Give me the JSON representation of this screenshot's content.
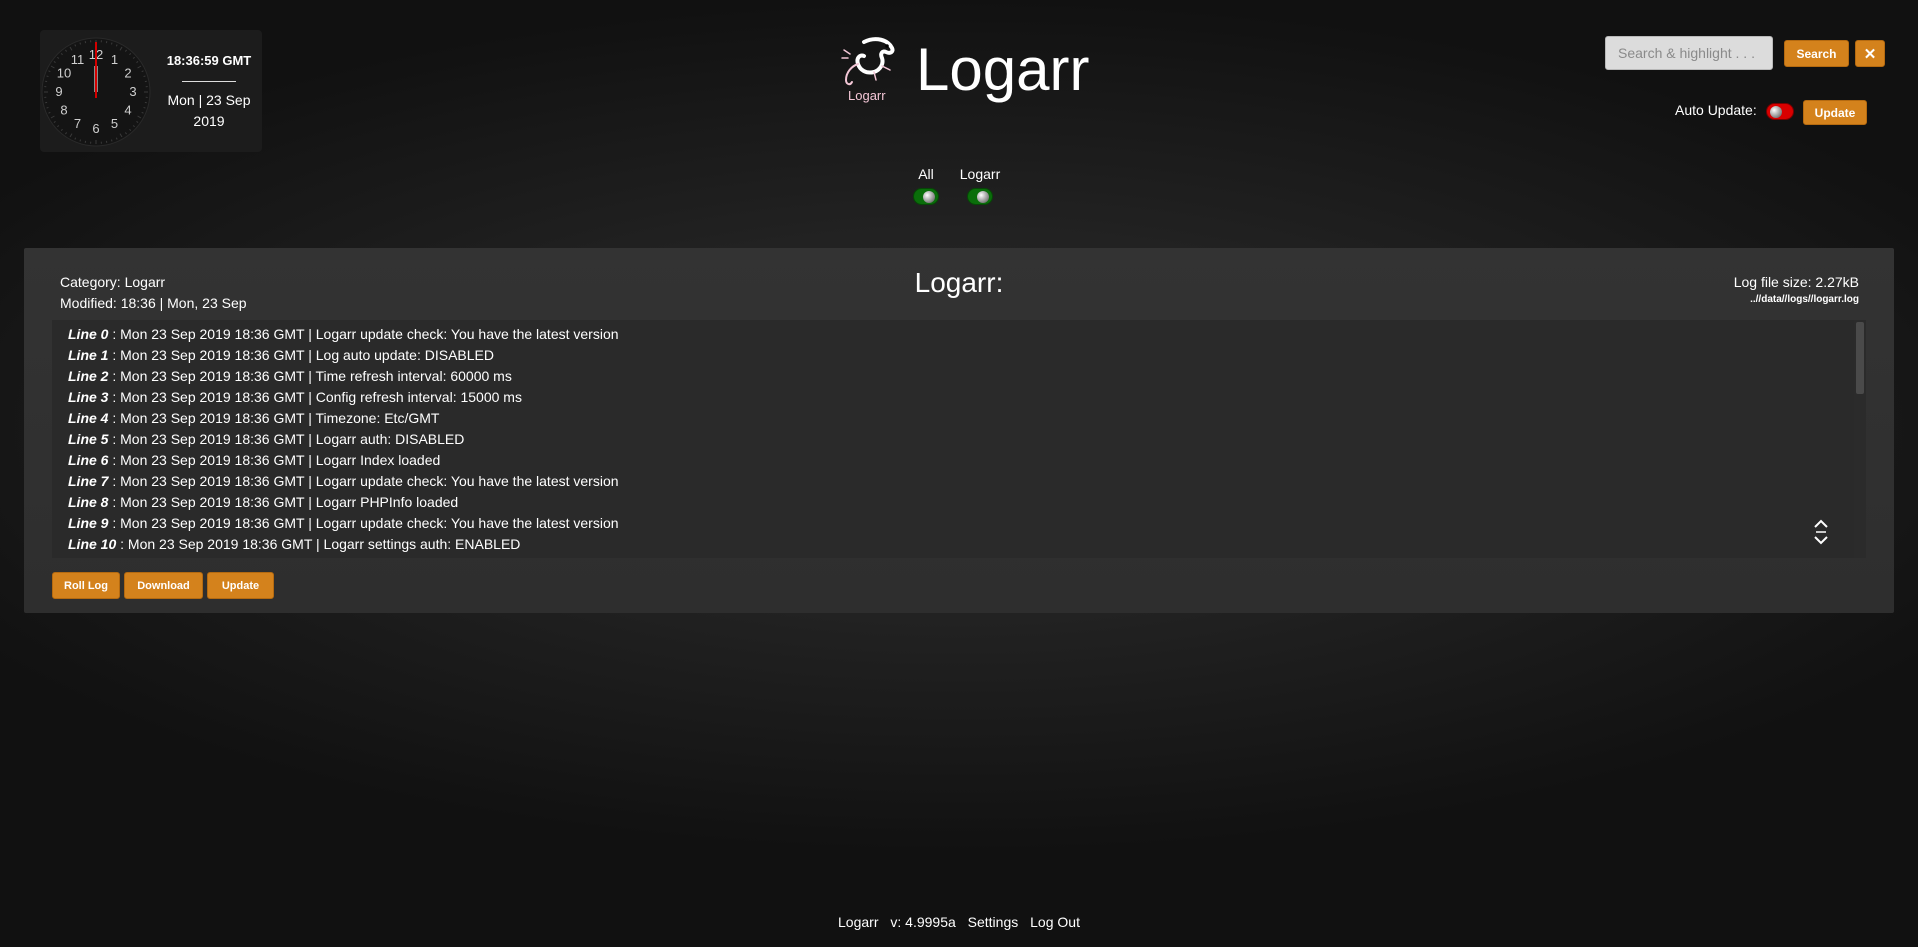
{
  "clock": {
    "time": "18:36:59 GMT",
    "date_line1": "Mon | 23 Sep",
    "date_line2": "2019",
    "numerals": [
      "12",
      "1",
      "2",
      "3",
      "4",
      "5",
      "6",
      "7",
      "8",
      "9",
      "10",
      "11"
    ]
  },
  "brand": {
    "logo_label": "Logarr",
    "title": "Logarr"
  },
  "search": {
    "placeholder": "Search & highlight . . .",
    "search_label": "Search",
    "clear_label": "✕"
  },
  "auto_update": {
    "label": "Auto Update:",
    "enabled": false,
    "update_label": "Update"
  },
  "filters": [
    {
      "label": "All",
      "enabled": true
    },
    {
      "label": "Logarr",
      "enabled": true
    }
  ],
  "log": {
    "category": "Category: Logarr",
    "modified": "Modified: 18:36 | Mon, 23 Sep",
    "title": "Logarr:",
    "size": "Log file size: 2.27kB",
    "path": "..//data//logs//logarr.log",
    "lines": [
      {
        "num": "Line 0",
        "text": " : Mon 23 Sep 2019 18:36 GMT | Logarr update check: You have the latest version"
      },
      {
        "num": "Line 1",
        "text": " : Mon 23 Sep 2019 18:36 GMT | Log auto update: DISABLED"
      },
      {
        "num": "Line 2",
        "text": " : Mon 23 Sep 2019 18:36 GMT | Time refresh interval: 60000 ms"
      },
      {
        "num": "Line 3",
        "text": " : Mon 23 Sep 2019 18:36 GMT | Config refresh interval: 15000 ms"
      },
      {
        "num": "Line 4",
        "text": " : Mon 23 Sep 2019 18:36 GMT | Timezone: Etc/GMT"
      },
      {
        "num": "Line 5",
        "text": " : Mon 23 Sep 2019 18:36 GMT | Logarr auth: DISABLED"
      },
      {
        "num": "Line 6",
        "text": " : Mon 23 Sep 2019 18:36 GMT | Logarr Index loaded"
      },
      {
        "num": "Line 7",
        "text": " : Mon 23 Sep 2019 18:36 GMT | Logarr update check: You have the latest version"
      },
      {
        "num": "Line 8",
        "text": " : Mon 23 Sep 2019 18:36 GMT | Logarr PHPInfo loaded"
      },
      {
        "num": "Line 9",
        "text": " : Mon 23 Sep 2019 18:36 GMT | Logarr update check: You have the latest version"
      },
      {
        "num": "Line 10",
        "text": " : Mon 23 Sep 2019 18:36 GMT | Logarr settings auth: ENABLED"
      }
    ],
    "buttons": {
      "roll": "Roll Log",
      "download": "Download",
      "update": "Update"
    }
  },
  "footer": {
    "app_name": "Logarr",
    "version": "v: 4.9995a",
    "settings": "Settings",
    "logout": "Log Out"
  },
  "colors": {
    "accent": "#d4821c",
    "toggle_on": "#0a6e0a",
    "toggle_off": "#d90000"
  }
}
